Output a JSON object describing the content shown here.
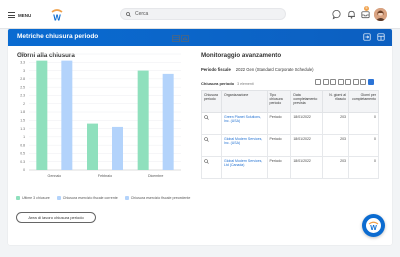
{
  "topbar": {
    "menu_label": "MENU",
    "search_placeholder": "Cerca",
    "notifications_badge": "5"
  },
  "page": {
    "title": "Metriche chiusura periodo"
  },
  "left_panel": {
    "title": "Giorni alla chiusura",
    "action_button": "Area di lavoro chiusura periodo"
  },
  "chart_data": {
    "type": "bar",
    "title": "",
    "xlabel": "",
    "ylabel": "",
    "ylim": [
      0,
      3.5
    ],
    "yticks": [
      "0",
      "0.3",
      "0.5",
      "0.8",
      "1",
      "1.3",
      "1.5",
      "1.8",
      "2",
      "2.3",
      "2.5",
      "2.8",
      "3",
      "3.3",
      "3.5"
    ],
    "categories": [
      "Gennaio",
      "Febbraio",
      "Dicembre"
    ],
    "series": [
      {
        "name": "Ultime 3 chiusure",
        "color": "#8fe0bd",
        "values": [
          3.3,
          1.4,
          3.0
        ]
      },
      {
        "name": "Chiusura esercizio fiscale corrente",
        "color": "#b3d3fb",
        "values": [
          3.3,
          1.3,
          2.9
        ]
      },
      {
        "name": "Chiusura esercizio fiscale precedente",
        "color": "#b3d3fb",
        "values": [
          null,
          null,
          null
        ]
      }
    ],
    "legend_position": "bottom"
  },
  "right_panel": {
    "title": "Monitoraggio avanzamento",
    "fiscal_period_label": "Periodo fiscale",
    "fiscal_period_value": "2022 Gen (Standard Corporate Schedule)",
    "table_title": "Chiusura periodo",
    "table_count": "3 elementi",
    "columns": [
      "Chiusura periodo",
      "Organizzazione",
      "Tipo chiusura periodo",
      "Data completamento prevista",
      "N. giorni al rilascio",
      "Giorni per completamento"
    ],
    "rows": [
      {
        "org": "Green Planet Solutions, Inc. (USA)",
        "type": "Periodo",
        "date": "18/01/2022",
        "days_release": "203",
        "days_complete": "0"
      },
      {
        "org": "Global Modern Services, Inc. (USA)",
        "type": "Periodo",
        "date": "18/01/2022",
        "days_release": "203",
        "days_complete": "0"
      },
      {
        "org": "Global Modern Services, Ltd (Canada)",
        "type": "Periodo",
        "date": "18/01/2022",
        "days_release": "203",
        "days_complete": "0"
      }
    ]
  },
  "colors": {
    "brand_blue": "#0b6bd0",
    "link_blue": "#1f6fd1",
    "accent_orange": "#f0a14b"
  }
}
